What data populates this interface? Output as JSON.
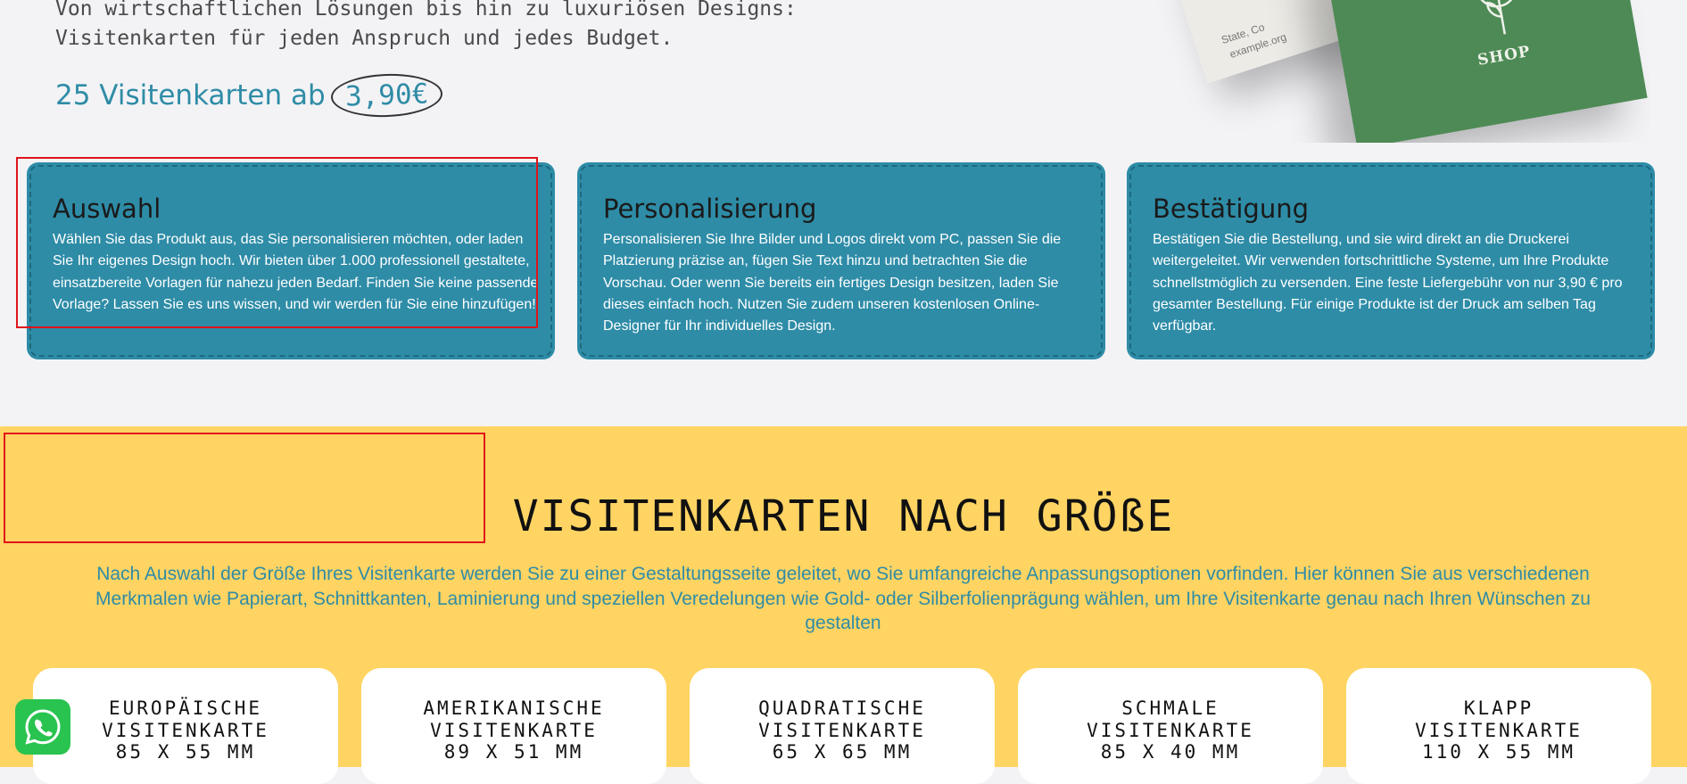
{
  "intro": {
    "line1": "Von wirtschaftlichen Lösungen bis hin zu luxuriösen Designs:",
    "line2": "Visitenkarten für jeden Anspruch und jedes Budget.",
    "price_prefix": "25 Visitenkarten ab",
    "price_value": "3,90€"
  },
  "card_image": {
    "white_card_lines": [
      "State, Co",
      "example.org"
    ],
    "shop_text": "SHOP"
  },
  "steps": [
    {
      "title": "Auswahl",
      "text": "Wählen Sie das Produkt aus, das Sie personalisieren möchten, oder laden Sie Ihr eigenes Design hoch. Wir bieten über 1.000 professionell gestaltete, einsatzbereite Vorlagen für nahezu jeden Bedarf. Finden Sie keine passende Vorlage? Lassen Sie es uns wissen, und wir werden für Sie eine hinzufügen!"
    },
    {
      "title": "Personalisierung",
      "text": "Personalisieren Sie Ihre Bilder und Logos direkt vom PC, passen Sie die Platzierung präzise an, fügen Sie Text hinzu und betrachten Sie die Vorschau. Oder wenn Sie bereits ein fertiges Design besitzen, laden Sie dieses einfach hoch. Nutzen Sie zudem unseren kostenlosen Online-Designer für Ihr individuelles Design."
    },
    {
      "title": "Bestätigung",
      "text": "Bestätigen Sie die Bestellung, und sie wird direkt an die Druckerei weitergeleitet. Wir verwenden fortschrittliche Systeme, um Ihre Produkte schnellstmöglich zu versenden. Eine feste Liefergebühr von nur 3,90 € pro gesamter Bestellung. Für einige Produkte ist der Druck am selben Tag verfügbar."
    }
  ],
  "sizes_section": {
    "title": "VISITENKARTEN NACH GRÖßE",
    "description": "Nach Auswahl der Größe Ihres Visitenkarte werden Sie zu einer Gestaltungsseite geleitet, wo Sie umfangreiche Anpassungsoptionen vorfinden. Hier können Sie aus verschiedenen Merkmalen wie Papierart, Schnittkanten, Laminierung und speziellen Veredelungen wie Gold- oder Silberfolienprägung wählen, um Ihre Visitenkarte genau nach Ihren Wünschen zu gestalten",
    "cards": [
      {
        "line1": "EUROPÄISCHE",
        "line2": "VISITENKARTE",
        "line3": "85 X 55 MM"
      },
      {
        "line1": "AMERIKANISCHE",
        "line2": "VISITENKARTE",
        "line3": "89 X 51 MM"
      },
      {
        "line1": "QUADRATISCHE",
        "line2": "VISITENKARTE",
        "line3": "65 X 65 MM"
      },
      {
        "line1": "SCHMALE",
        "line2": "VISITENKARTE",
        "line3": "85 X 40 MM"
      },
      {
        "line1": "KLAPP",
        "line2": "VISITENKARTE",
        "line3": "110 X 55 MM"
      }
    ]
  },
  "colors": {
    "teal": "#2e8ca7",
    "yellow": "#ffd463",
    "highlight_red": "#e0141a",
    "whatsapp_green": "#29c34f"
  },
  "icons": [
    "plant-logo-icon",
    "whatsapp-icon"
  ]
}
